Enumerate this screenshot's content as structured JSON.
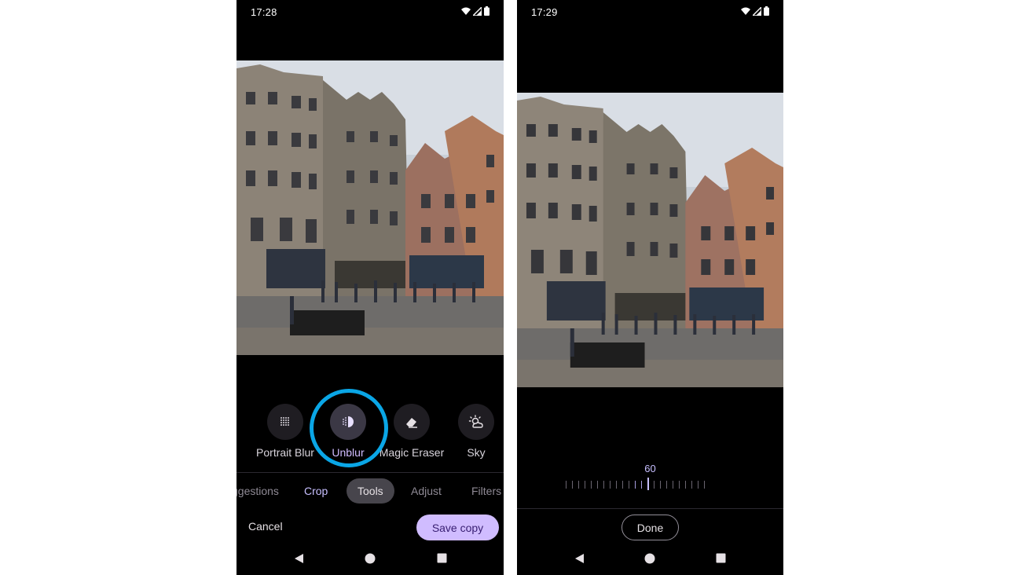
{
  "left_screen": {
    "status": {
      "time": "17:28"
    },
    "tools": [
      {
        "label": "Portrait Blur",
        "icon": "portrait-blur-icon"
      },
      {
        "label": "Unblur",
        "icon": "unblur-icon",
        "active": true
      },
      {
        "label": "Magic Eraser",
        "icon": "eraser-icon"
      },
      {
        "label": "Sky",
        "icon": "sky-icon"
      }
    ],
    "tabs": [
      "ggestions",
      "Crop",
      "Tools",
      "Adjust",
      "Filters"
    ],
    "selected_tab": "Tools",
    "cancel_label": "Cancel",
    "save_label": "Save copy"
  },
  "right_screen": {
    "status": {
      "time": "17:29"
    },
    "slider_value": "60",
    "done_label": "Done"
  },
  "colors": {
    "accent": "#d0bcff",
    "highlight_ring": "#0aa6e6",
    "background": "#000000"
  }
}
